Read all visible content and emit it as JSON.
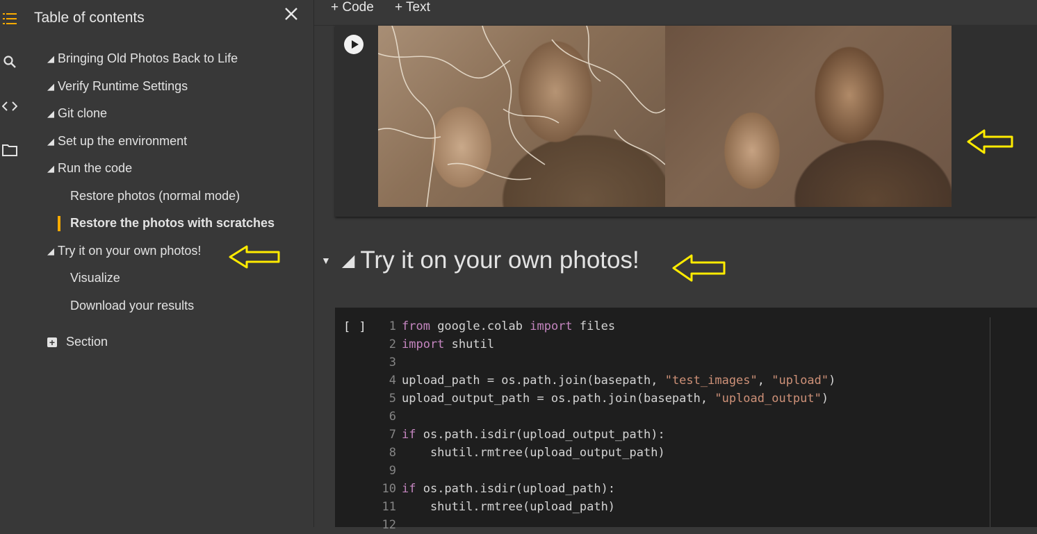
{
  "rail": {
    "icons": [
      "toc-icon",
      "search-icon",
      "code-icon",
      "folder-icon"
    ],
    "accent_color": "#f9ab00"
  },
  "toc": {
    "title": "Table of contents",
    "items": [
      {
        "label": "Bringing Old Photos Back to Life",
        "level": 1
      },
      {
        "label": "Verify Runtime Settings",
        "level": 1
      },
      {
        "label": "Git clone",
        "level": 1
      },
      {
        "label": "Set up the environment",
        "level": 1
      },
      {
        "label": "Run the code",
        "level": 1
      },
      {
        "label": "Restore photos (normal mode)",
        "level": 2
      },
      {
        "label": "Restore the photos with scratches",
        "level": 2,
        "active": true
      },
      {
        "label": "Try it on your own photos!",
        "level": 1
      },
      {
        "label": "Visualize",
        "level": 2
      },
      {
        "label": "Download your results",
        "level": 2
      }
    ],
    "add_section_label": "Section"
  },
  "toolbar": {
    "add_code_label": "+ Code",
    "add_text_label": "+ Text"
  },
  "output_cell": {
    "images": [
      "old-damaged-photo",
      "restored-photo"
    ]
  },
  "section_heading": "Try it on your own photos!",
  "annotation_color": "#ffeb00",
  "code_cell": {
    "run_indicator": "[ ]",
    "lines": [
      [
        {
          "t": "from",
          "c": "kw"
        },
        {
          "t": " google.colab "
        },
        {
          "t": "import",
          "c": "kw"
        },
        {
          "t": " files"
        }
      ],
      [
        {
          "t": "import",
          "c": "kw"
        },
        {
          "t": " shutil"
        }
      ],
      [],
      [
        {
          "t": "upload_path = os.path.join(basepath, "
        },
        {
          "t": "\"test_images\"",
          "c": "str"
        },
        {
          "t": ", "
        },
        {
          "t": "\"upload\"",
          "c": "str"
        },
        {
          "t": ")"
        }
      ],
      [
        {
          "t": "upload_output_path = os.path.join(basepath, "
        },
        {
          "t": "\"upload_output\"",
          "c": "str"
        },
        {
          "t": ")"
        }
      ],
      [],
      [
        {
          "t": "if",
          "c": "kw"
        },
        {
          "t": " os.path.isdir(upload_output_path):"
        }
      ],
      [
        {
          "t": "    shutil.rmtree(upload_output_path)"
        }
      ],
      [],
      [
        {
          "t": "if",
          "c": "kw"
        },
        {
          "t": " os.path.isdir(upload_path):"
        }
      ],
      [
        {
          "t": "    shutil.rmtree(upload_path)"
        }
      ],
      []
    ]
  }
}
